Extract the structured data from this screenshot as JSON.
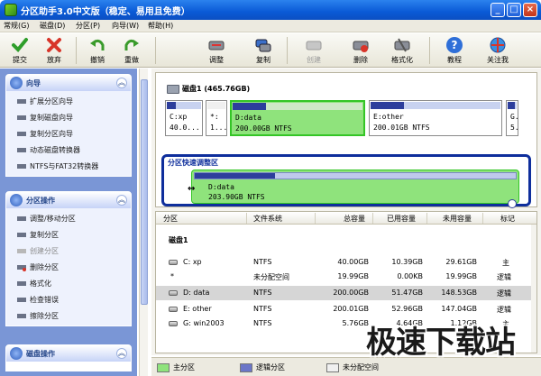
{
  "window": {
    "title": "分区助手3.0中文版（稳定、易用且免费）",
    "buttons": [
      "_",
      "□",
      "×"
    ]
  },
  "menu": [
    "常规(G)",
    "磁盘(D)",
    "分区(P)",
    "向导(W)",
    "帮助(H)"
  ],
  "toolbar": {
    "submit": "提交",
    "discard": "放弃",
    "undo": "撤销",
    "redo": "重做",
    "resize": "调整",
    "copy": "复制",
    "create": "创建",
    "delete": "删除",
    "format": "格式化",
    "tutorial": "教程",
    "follow": "关注我"
  },
  "sidebar": {
    "wizard": {
      "title": "向导",
      "items": [
        {
          "label": "扩展分区向导",
          "disabled": false
        },
        {
          "label": "复制磁盘向导",
          "disabled": false
        },
        {
          "label": "复制分区向导",
          "disabled": false
        },
        {
          "label": "动态磁盘转换器",
          "disabled": false
        },
        {
          "label": "NTFS与FAT32转换器",
          "disabled": false
        }
      ]
    },
    "partition_ops": {
      "title": "分区操作",
      "items": [
        {
          "label": "调整/移动分区",
          "disabled": false
        },
        {
          "label": "复制分区",
          "disabled": false
        },
        {
          "label": "创建分区",
          "disabled": true
        },
        {
          "label": "删除分区",
          "disabled": false
        },
        {
          "label": "格式化",
          "disabled": false
        },
        {
          "label": "检查错误",
          "disabled": false
        },
        {
          "label": "擦除分区",
          "disabled": false
        }
      ]
    },
    "disk_ops": {
      "title": "磁盘操作"
    }
  },
  "disk_map": {
    "label": "磁盘1 (465.76GB)",
    "blocks": [
      {
        "line1": "C:xp",
        "line2": "40.0...",
        "used": 0.26,
        "selected": false
      },
      {
        "line1": "*:",
        "line2": "1...",
        "used": 0.0,
        "selected": false
      },
      {
        "line1": "D:data",
        "line2": "200.00GB NTFS",
        "used": 0.26,
        "selected": true
      },
      {
        "line1": "E:other",
        "line2": "200.01GB NTFS",
        "used": 0.26,
        "selected": false
      },
      {
        "line1": "G.",
        "line2": "5.",
        "used": 0.8,
        "selected": false
      }
    ],
    "quick": {
      "title": "分区快速调整区",
      "line1": "D:data",
      "line2": "203.90GB NTFS",
      "used": 0.25
    }
  },
  "table": {
    "headers": [
      "分区",
      "文件系统",
      "总容量",
      "已用容量",
      "未用容量",
      "标记"
    ],
    "group": "磁盘1",
    "rows": [
      {
        "name": "C:  xp",
        "fs": "NTFS",
        "total": "40.00GB",
        "used": "10.39GB",
        "free": "29.61GB",
        "flag": "主",
        "selected": false
      },
      {
        "name": "*",
        "fs": "未分配空间",
        "total": "19.99GB",
        "used": "0.00KB",
        "free": "19.99GB",
        "flag": "逻辑",
        "selected": false
      },
      {
        "name": "D:  data",
        "fs": "NTFS",
        "total": "200.00GB",
        "used": "51.47GB",
        "free": "148.53GB",
        "flag": "逻辑",
        "selected": true
      },
      {
        "name": "E:  other",
        "fs": "NTFS",
        "total": "200.01GB",
        "used": "52.96GB",
        "free": "147.04GB",
        "flag": "逻辑",
        "selected": false
      },
      {
        "name": "G:  win2003",
        "fs": "NTFS",
        "total": "5.76GB",
        "used": "4.64GB",
        "free": "1.12GB",
        "flag": "主",
        "selected": false
      }
    ]
  },
  "legend": {
    "primary": "主分区",
    "logical": "逻辑分区",
    "unallocated": "未分配空间"
  },
  "watermark": "极速下载站",
  "colors": {
    "primary": "#8fe37c",
    "logical": "#6b76c8",
    "unallocated": "#f0f0f0",
    "used_fill": "#2d3e9c",
    "title_blue": "#0a5ad6"
  }
}
